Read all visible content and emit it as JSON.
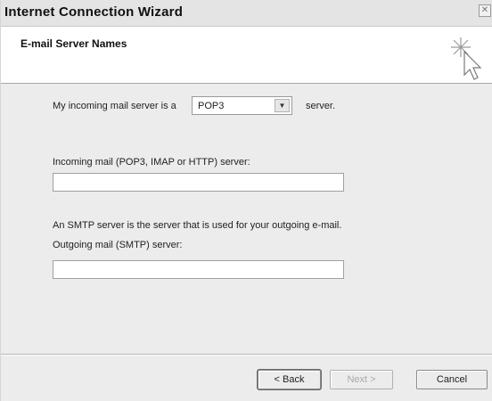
{
  "window": {
    "title": "Internet Connection Wizard",
    "close_glyph": "✕"
  },
  "header": {
    "title": "E-mail Server Names",
    "icon": "wizard-sparkle-cursor-icon"
  },
  "form": {
    "incoming_type_prefix": "My incoming mail server is a",
    "incoming_type_value": "POP3",
    "incoming_type_suffix": "server.",
    "incoming_label": "Incoming mail (POP3, IMAP or HTTP) server:",
    "incoming_value": "",
    "smtp_note": "An SMTP server is the server that is used for your outgoing e-mail.",
    "outgoing_label": "Outgoing mail (SMTP) server:",
    "outgoing_value": ""
  },
  "buttons": {
    "back": "< Back",
    "next": "Next >",
    "cancel": "Cancel"
  }
}
